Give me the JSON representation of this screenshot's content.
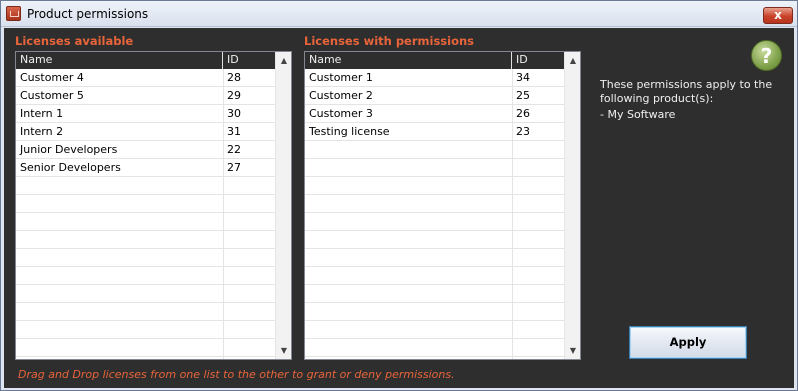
{
  "window": {
    "title": "Product permissions",
    "close_glyph": "x"
  },
  "available": {
    "label": "Licenses available",
    "columns": [
      "Name",
      "ID"
    ],
    "rows": [
      [
        "Customer 4",
        "28"
      ],
      [
        "Customer 5",
        "29"
      ],
      [
        "Intern 1",
        "30"
      ],
      [
        "Intern 2",
        "31"
      ],
      [
        "Junior Developers",
        "22"
      ],
      [
        "Senior Developers",
        "27"
      ]
    ]
  },
  "permitted": {
    "label": "Licenses with permissions",
    "columns": [
      "Name",
      "ID"
    ],
    "rows": [
      [
        "Customer 1",
        "34"
      ],
      [
        "Customer 2",
        "25"
      ],
      [
        "Customer 3",
        "26"
      ],
      [
        "Testing license",
        "23"
      ]
    ]
  },
  "info": {
    "help_glyph": "?",
    "lines": [
      "These permissions apply to the",
      "following product(s):",
      "- My Software"
    ]
  },
  "apply_label": "Apply",
  "hint": "Drag and Drop licenses from one list to the other to grant or deny permissions.",
  "colors": {
    "accent": "#e8643a",
    "panel_background": "#2e2e2e",
    "help_icon": "#7ea14a"
  }
}
